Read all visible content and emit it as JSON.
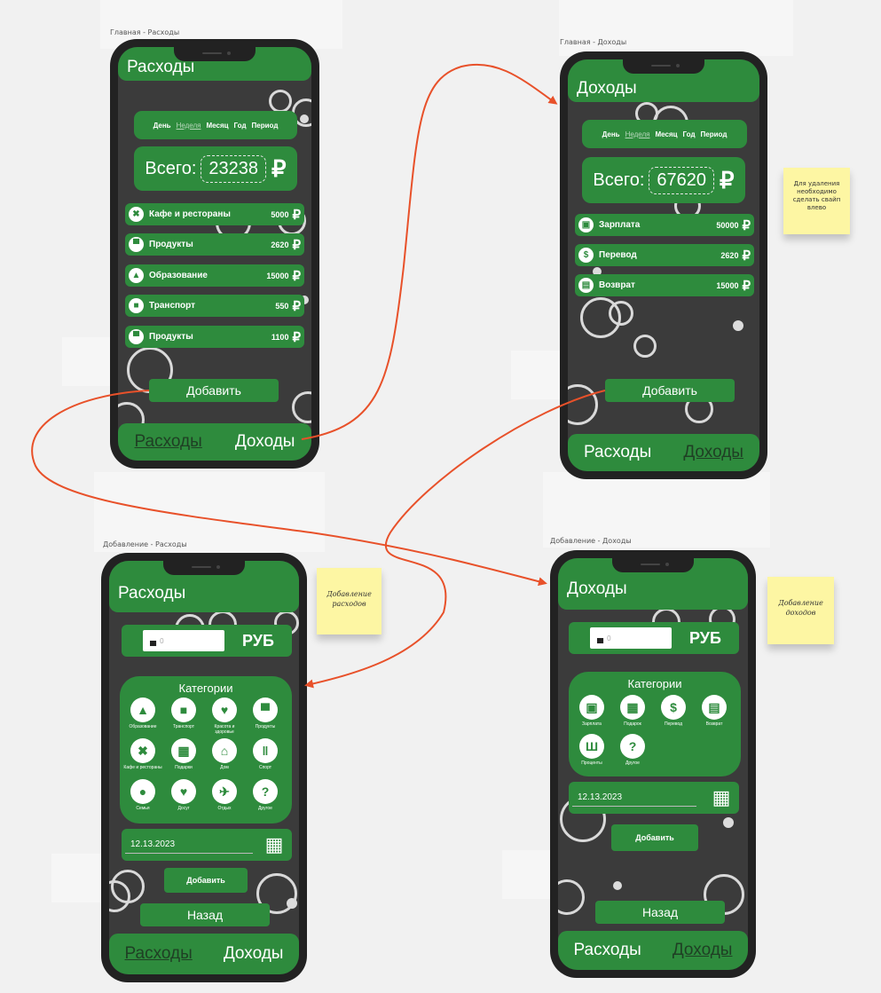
{
  "board": {
    "frames": [
      {
        "label": "Главная - Расходы"
      },
      {
        "label": "Главная - Доходы"
      },
      {
        "label": "Добавление - Расходы"
      },
      {
        "label": "Добавление - Доходы"
      }
    ],
    "notes": [
      {
        "text": "Для удаления необходимо сделать свайп влево"
      },
      {
        "text": "Добавление расходов"
      },
      {
        "text": "Добавление доходов"
      }
    ]
  },
  "expenses_main": {
    "title": "Расходы",
    "periods": [
      "День",
      "Неделя",
      "Месяц",
      "Год",
      "Период"
    ],
    "total_label": "Всего:",
    "total_value": "23238",
    "currency_symbol": "₽",
    "items": [
      {
        "icon": "cutlery-icon",
        "name": "Кафе и рестораны",
        "amount": "5000"
      },
      {
        "icon": "basket-icon",
        "name": "Продукты",
        "amount": "2620"
      },
      {
        "icon": "graduation-cap-icon",
        "name": "Образование",
        "amount": "15000"
      },
      {
        "icon": "bus-icon",
        "name": "Транспорт",
        "amount": "550"
      },
      {
        "icon": "basket-icon",
        "name": "Продукты",
        "amount": "1100"
      }
    ],
    "add_button": "Добавить",
    "nav": {
      "expenses": "Расходы",
      "income": "Доходы"
    }
  },
  "income_main": {
    "title": "Доходы",
    "periods": [
      "День",
      "Неделя",
      "Месяц",
      "Год",
      "Период"
    ],
    "total_label": "Всего:",
    "total_value": "67620",
    "currency_symbol": "₽",
    "items": [
      {
        "icon": "wallet-icon",
        "name": "Зарплата",
        "amount": "50000"
      },
      {
        "icon": "transfer-icon",
        "name": "Перевод",
        "amount": "2620"
      },
      {
        "icon": "cash-icon",
        "name": "Возврат",
        "amount": "15000"
      }
    ],
    "add_button": "Добавить",
    "nav": {
      "expenses": "Расходы",
      "income": "Доходы"
    }
  },
  "expenses_add": {
    "title": "Расходы",
    "amount_placeholder": "0",
    "currency": "РУБ",
    "categories_title": "Категории",
    "categories": [
      {
        "icon": "graduation-cap-icon",
        "label": "Образование"
      },
      {
        "icon": "bus-icon",
        "label": "Транспорт"
      },
      {
        "icon": "heart-pulse-icon",
        "label": "Красота и здоровье"
      },
      {
        "icon": "basket-icon",
        "label": "Продукты"
      },
      {
        "icon": "cutlery-icon",
        "label": "Кафе и рестораны"
      },
      {
        "icon": "gift-icon",
        "label": "Подарки"
      },
      {
        "icon": "home-icon",
        "label": "Дом"
      },
      {
        "icon": "dumbbell-icon",
        "label": "Спорт"
      },
      {
        "icon": "family-icon",
        "label": "Семья"
      },
      {
        "icon": "heart-icon",
        "label": "Досуг"
      },
      {
        "icon": "plane-icon",
        "label": "Отдых"
      },
      {
        "icon": "question-icon",
        "label": "Другое"
      }
    ],
    "date": "12.13.2023",
    "add_button": "Добавить",
    "back_button": "Назад",
    "nav": {
      "expenses": "Расходы",
      "income": "Доходы"
    }
  },
  "income_add": {
    "title": "Доходы",
    "amount_placeholder": "0",
    "currency": "РУБ",
    "categories_title": "Категории",
    "categories": [
      {
        "icon": "wallet-icon",
        "label": "Зарплата"
      },
      {
        "icon": "gift-icon",
        "label": "Подарок"
      },
      {
        "icon": "transfer-icon",
        "label": "Перевод"
      },
      {
        "icon": "cash-icon",
        "label": "Возврат"
      },
      {
        "icon": "bank-icon",
        "label": "Проценты"
      },
      {
        "icon": "question-icon",
        "label": "Другое"
      }
    ],
    "date": "12.13.2023",
    "add_button": "Добавить",
    "back_button": "Назад",
    "nav": {
      "expenses": "Расходы",
      "income": "Доходы"
    }
  },
  "colors": {
    "accent_green": "#2e8b3d",
    "screen_bg": "#3b3b3b",
    "phone_body": "#222222",
    "sticky_note": "#fdf6a3",
    "arrow": "#e8512a"
  }
}
